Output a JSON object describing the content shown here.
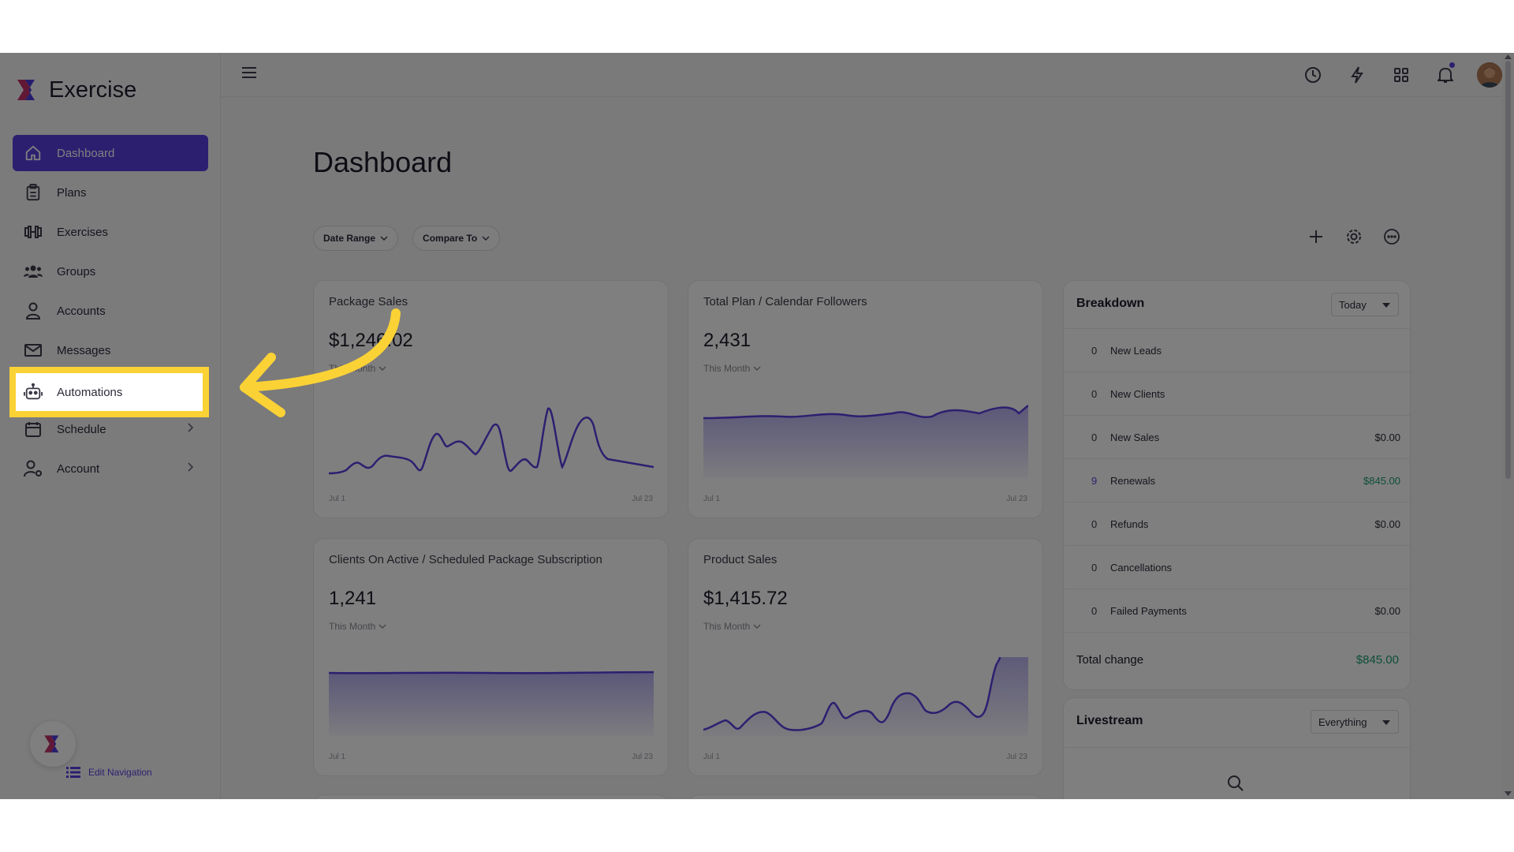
{
  "app": {
    "name": "Exercise"
  },
  "sidebar": {
    "items": [
      {
        "label": "Dashboard",
        "icon": "home-icon",
        "active": true
      },
      {
        "label": "Plans",
        "icon": "clipboard-icon"
      },
      {
        "label": "Exercises",
        "icon": "dumbbell-icon"
      },
      {
        "label": "Groups",
        "icon": "users-icon"
      },
      {
        "label": "Accounts",
        "icon": "user-icon"
      },
      {
        "label": "Messages",
        "icon": "mail-icon"
      },
      {
        "label": "Automations",
        "icon": "robot-icon",
        "highlighted": true
      },
      {
        "label": "Schedule",
        "icon": "calendar-icon",
        "has_children": true
      },
      {
        "label": "Account",
        "icon": "user-settings-icon",
        "has_children": true
      }
    ],
    "edit_navigation": "Edit Navigation"
  },
  "topbar": {
    "icons": [
      "history-icon",
      "lightning-icon",
      "grid-icon",
      "bell-icon",
      "user-avatar"
    ]
  },
  "page": {
    "title": "Dashboard",
    "filters": {
      "date_range": "Date Range",
      "compare_to": "Compare To"
    },
    "actions": [
      "plus-icon",
      "gear-icon",
      "more-icon"
    ]
  },
  "cards": [
    {
      "title": "Package Sales",
      "value": "$1,246.02",
      "period": "This Month",
      "x_start": "Jul 1",
      "x_end": "Jul 23"
    },
    {
      "title": "Total Plan / Calendar Followers",
      "value": "2,431",
      "period": "This Month",
      "x_start": "Jul 1",
      "x_end": "Jul 23"
    },
    {
      "title": "Clients On Active / Scheduled Package Subscription",
      "value": "1,241",
      "period": "This Month",
      "x_start": "Jul 1",
      "x_end": "Jul 23"
    },
    {
      "title": "Product Sales",
      "value": "$1,415.72",
      "period": "This Month",
      "x_start": "Jul 1",
      "x_end": "Jul 23"
    }
  ],
  "breakdown": {
    "title": "Breakdown",
    "period": "Today",
    "rows": [
      {
        "count": "0",
        "label": "New Leads",
        "value": ""
      },
      {
        "count": "0",
        "label": "New Clients",
        "value": ""
      },
      {
        "count": "0",
        "label": "New Sales",
        "value": "$0.00"
      },
      {
        "count": "9",
        "label": "Renewals",
        "value": "$845.00"
      },
      {
        "count": "0",
        "label": "Refunds",
        "value": "$0.00"
      },
      {
        "count": "0",
        "label": "Cancellations",
        "value": ""
      },
      {
        "count": "0",
        "label": "Failed Payments",
        "value": "$0.00"
      }
    ],
    "total_label": "Total change",
    "total_value": "$845.00"
  },
  "livestream": {
    "title": "Livestream",
    "filter": "Everything"
  },
  "colors": {
    "accent": "#5b3ee0",
    "highlight": "#fbd235",
    "positive": "#1a9c70"
  }
}
